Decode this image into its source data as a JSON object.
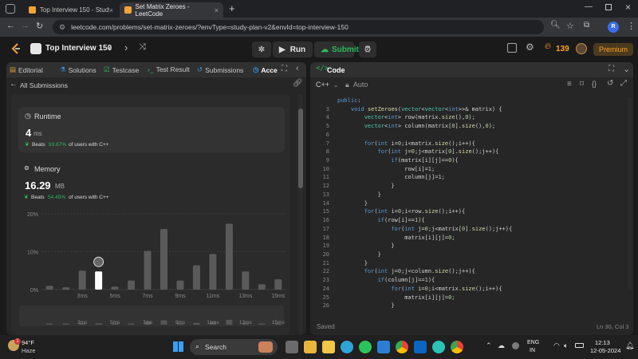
{
  "browser": {
    "tabs": [
      {
        "title": "Top Interview 150 - Study Plan - Le"
      },
      {
        "title": "Set Matrix Zeroes - LeetCode"
      }
    ],
    "url": "leetcode.com/problems/set-matrix-zeroes/?envType=study-plan-v2&envId=top-interview-150",
    "profile_initial": "R"
  },
  "leetcode": {
    "study_title": "Top Interview 150",
    "run_label": "Run",
    "submit_label": "Submit",
    "streak_count": "139",
    "premium_label": "Premium"
  },
  "left_tabs": [
    "Editorial",
    "Solutions",
    "Testcase",
    "Test Result",
    "Submissions",
    "Acce"
  ],
  "submissions": {
    "back_label": "All Submissions",
    "runtime": {
      "title": "Runtime",
      "value": "4",
      "unit": "ms",
      "beats_prefix": "Beats",
      "beats_pct": "93.67%",
      "beats_suffix": "of users with C++"
    },
    "memory": {
      "title": "Memory",
      "value": "16.29",
      "unit": "MB",
      "beats_prefix": "Beats",
      "beats_pct": "54.45%",
      "beats_suffix": "of users with C++"
    }
  },
  "chart_data": {
    "type": "bar",
    "ylim": [
      0,
      20
    ],
    "yticks": [
      "20%",
      "10%",
      "0%"
    ],
    "xticks": [
      "3ms",
      "5ms",
      "7ms",
      "9ms",
      "11ms",
      "13ms",
      "15ms"
    ],
    "values": [
      1.0,
      0.6,
      5.0,
      4.8,
      0.8,
      2.4,
      10.2,
      16.0,
      2.4,
      6.4,
      9.4,
      17.4,
      4.8,
      1.4,
      2.7
    ],
    "highlight_index": 3,
    "colors": {
      "bar": "#5a5a5a",
      "highlight": "#ffffff"
    }
  },
  "editor": {
    "title": "Code",
    "language": "C++",
    "mode": "Auto",
    "status_left": "Saved",
    "status_right": "Ln 30, Col 3",
    "lines": [
      {
        "n": "",
        "t": "public:"
      },
      {
        "n": "3",
        "t": "    void setZeroes(vector<vector<int>>& matrix) {"
      },
      {
        "n": "4",
        "t": "        vector<int> row(matrix.size(),0);"
      },
      {
        "n": "5",
        "t": "        vector<int> column(matrix[0].size(),0);"
      },
      {
        "n": "6",
        "t": ""
      },
      {
        "n": "7",
        "t": "        for(int i=0;i<matrix.size();i++){"
      },
      {
        "n": "8",
        "t": "            for(int j=0;j<matrix[0].size();j++){"
      },
      {
        "n": "9",
        "t": "                if(matrix[i][j]==0){"
      },
      {
        "n": "10",
        "t": "                    row[i]=1;"
      },
      {
        "n": "11",
        "t": "                    column[j]=1;"
      },
      {
        "n": "12",
        "t": "                }"
      },
      {
        "n": "13",
        "t": "            }"
      },
      {
        "n": "14",
        "t": "        }"
      },
      {
        "n": "15",
        "t": "        for(int i=0;i<row.size();i++){"
      },
      {
        "n": "16",
        "t": "            if(row[i]==1){"
      },
      {
        "n": "17",
        "t": "                for(int j=0;j<matrix[0].size();j++){"
      },
      {
        "n": "18",
        "t": "                    matrix[i][j]=0;"
      },
      {
        "n": "19",
        "t": "                }"
      },
      {
        "n": "20",
        "t": "            }"
      },
      {
        "n": "21",
        "t": "        }"
      },
      {
        "n": "22",
        "t": "        for(int j=0;j<column.size();j++){"
      },
      {
        "n": "23",
        "t": "            if(column[j]==1){"
      },
      {
        "n": "24",
        "t": "                for(int i=0;i<matrix.size();i++){"
      },
      {
        "n": "25",
        "t": "                    matrix[i][j]=0;"
      },
      {
        "n": "26",
        "t": "                }"
      }
    ]
  },
  "taskbar": {
    "weather_temp": "94°F",
    "weather_desc": "Haze",
    "weather_badge": "1",
    "search_label": "Search",
    "lang_line1": "ENG",
    "lang_line2": "IN",
    "time": "12:13",
    "date": "12-05-2024"
  }
}
